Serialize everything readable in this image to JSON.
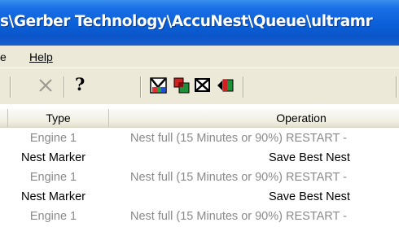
{
  "window": {
    "title": "s\\Gerber Technology\\AccuNest\\Queue\\ultramr"
  },
  "menu": {
    "items": [
      {
        "label": "e"
      },
      {
        "label": "Help"
      }
    ]
  },
  "toolbar": {
    "help_glyph": "?",
    "icons": [
      "delete-icon",
      "help-icon",
      "marker-icon",
      "copy-icon",
      "cancel-icon",
      "arrow-icon"
    ]
  },
  "table": {
    "columns": [
      "Type",
      "Operation"
    ],
    "rows": [
      {
        "type": "Engine 1",
        "operation": "Nest full (15 Minutes or 90%) RESTART -"
      },
      {
        "type": "Nest Marker",
        "operation": "Save Best Nest"
      },
      {
        "type": "Engine 1",
        "operation": "Nest full (15 Minutes or 90%) RESTART -"
      },
      {
        "type": "Nest Marker",
        "operation": "Save Best Nest"
      },
      {
        "type": "Engine 1",
        "operation": "Nest full (15 Minutes or 90%) RESTART -"
      }
    ]
  },
  "colors": {
    "titlebar": "#0a5fd8",
    "chrome": "#ece9d8",
    "dim_text": "#8a8a8a"
  }
}
